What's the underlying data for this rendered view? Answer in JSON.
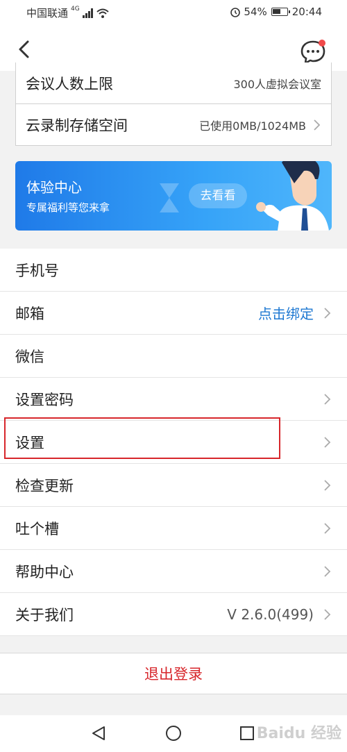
{
  "status": {
    "carrier": "中国联通",
    "network": "4G",
    "battery": "54%",
    "time": "20:44"
  },
  "account_card": {
    "rows": [
      {
        "label": "会议人数上限",
        "value": "300人虚拟会议室"
      },
      {
        "label": "云录制存储空间",
        "value": "已使用0MB/1024MB"
      }
    ]
  },
  "banner": {
    "title": "体验中心",
    "subtitle": "专属福利等您来拿",
    "button": "去看看"
  },
  "settings_list": [
    {
      "label": "手机号",
      "value": ""
    },
    {
      "label": "邮箱",
      "value": "点击绑定"
    },
    {
      "label": "微信",
      "value": ""
    },
    {
      "label": "设置密码",
      "value": ""
    },
    {
      "label": "设置",
      "value": ""
    },
    {
      "label": "检查更新",
      "value": ""
    },
    {
      "label": "吐个槽",
      "value": ""
    },
    {
      "label": "帮助中心",
      "value": ""
    },
    {
      "label": "关于我们",
      "value": "V 2.6.0(499)"
    }
  ],
  "logout_label": "退出登录",
  "watermark": "Baidu 经验",
  "icons": [
    "back-icon",
    "chat-icon",
    "chevron-right-icon",
    "nav-back-icon",
    "nav-home-icon",
    "nav-recent-icon"
  ],
  "colors": {
    "accent": "#1e78d2",
    "danger": "#d7262b",
    "banner": "#2b8ef0"
  }
}
